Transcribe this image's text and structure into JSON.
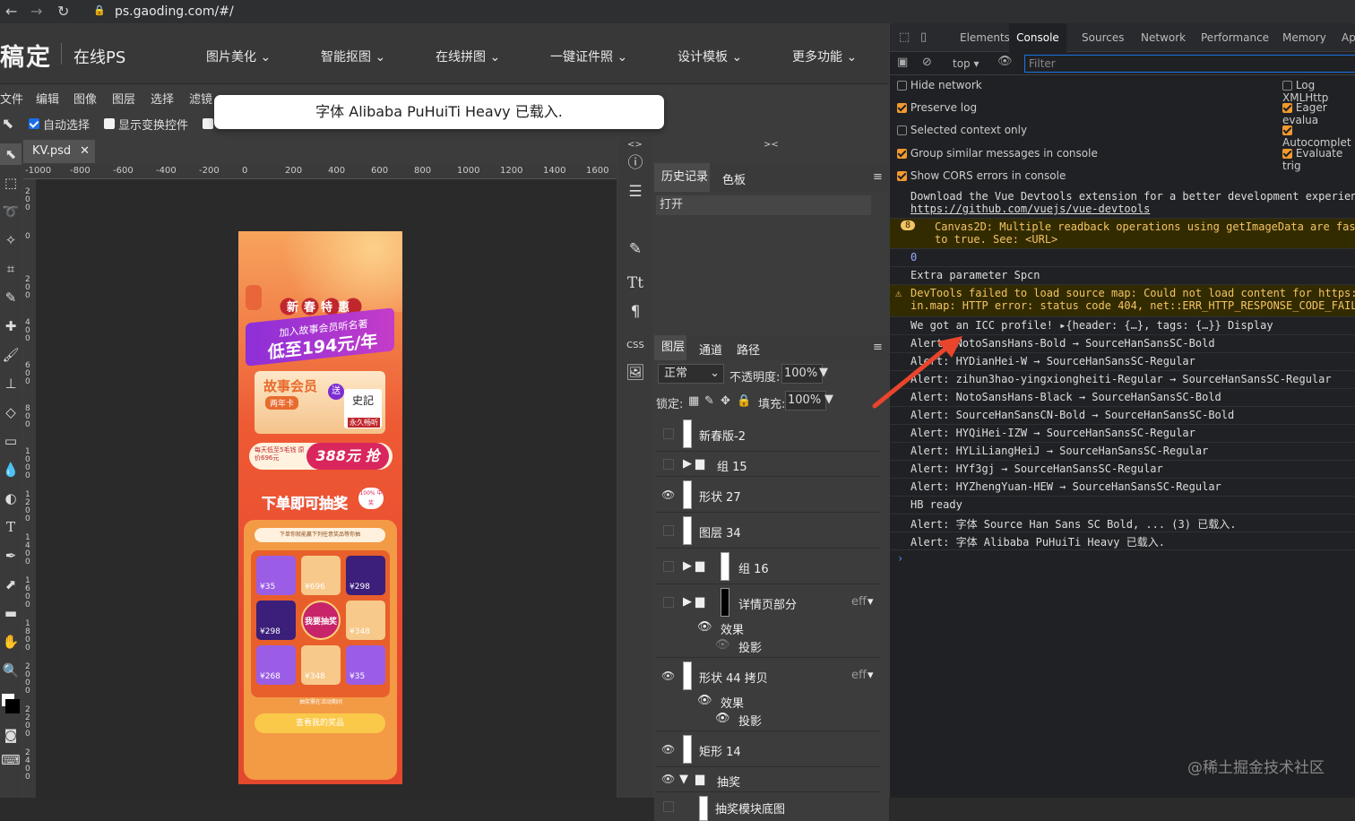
{
  "browser": {
    "url": "ps.gaoding.com/#/"
  },
  "ps": {
    "logo": "稿定",
    "logo_sub": "在线PS",
    "topnav": [
      "图片美化 ⌄",
      "智能抠图 ⌄",
      "在线拼图 ⌄",
      "一键证件照 ⌄",
      "设计模板 ⌄",
      "更多功能 ⌄"
    ],
    "menus": [
      "文件",
      "编辑",
      "图像",
      "图层",
      "选择",
      "滤镜"
    ],
    "options": {
      "auto_select": "自动选择",
      "show_transform": "显示变换控件"
    },
    "toast": "字体 Alibaba PuHuiTi Heavy 已载入.",
    "doc_tab": "KV.psd",
    "ruler_h": [
      "-1000",
      "-800",
      "-600",
      "-400",
      "-200",
      "0",
      "200",
      "400",
      "600",
      "800",
      "1000",
      "1200",
      "1400",
      "1600"
    ],
    "ruler_v": [
      "200",
      "0",
      "200",
      "400",
      "600",
      "800",
      "1000",
      "1200",
      "1400",
      "1600",
      "1800",
      "2000",
      "2200",
      "2400"
    ],
    "history": {
      "tabs": [
        "历史记录",
        "色板"
      ],
      "item": "打开"
    },
    "layers_panel": {
      "tabs": [
        "图层",
        "通道",
        "路径"
      ],
      "blend": "正常",
      "opacity_label": "不透明度:",
      "opacity": "100%",
      "lock_label": "锁定:",
      "fill_label": "填充:",
      "fill": "100%",
      "layers": [
        "新春版-2",
        "组 15",
        "形状 27",
        "图层 34",
        "组 16",
        "详情页部分",
        "效果",
        "投影",
        "形状 44 拷贝",
        "效果",
        "投影",
        "矩形 14",
        "抽奖",
        "抽奖模块底图"
      ],
      "eff": "eff"
    },
    "artboard": {
      "badge": "新春特惠",
      "headline1": "加入故事会员听名著",
      "headline2": "低至194元/年",
      "card_title": "故事会员",
      "card_sub": "两年卡",
      "gift": "送",
      "book": "史記",
      "book_sub": "永久畅听",
      "price_small": "每天低至5毛钱 原价696元",
      "price_big": "388元 抢",
      "lottery": "下单即可抽奖",
      "lottery_badge": "100% 中奖",
      "grid_title": "下单你就能赢下列任意奖品等你抽",
      "grid_prices": [
        "¥35",
        "¥696",
        "¥298",
        "¥298",
        "",
        "¥348",
        "¥268",
        "¥348",
        "¥35"
      ],
      "center_btn": "我要抽奖",
      "btn": "查看我的奖品",
      "footnote": "抽奖需在活动期间"
    }
  },
  "devtools": {
    "tabs": [
      "Elements",
      "Console",
      "Sources",
      "Network",
      "Performance",
      "Memory",
      "Ap"
    ],
    "context": "top ▾",
    "filter_placeholder": "Filter",
    "options_left": [
      "Hide network",
      "Preserve log",
      "Selected context only",
      "Group similar messages in console",
      "Show CORS errors in console"
    ],
    "options_right": [
      "Log XMLHttp",
      "Eager evalua",
      "Autocomplet",
      "Evaluate trig"
    ],
    "logs": {
      "l1a": "Download the Vue Devtools extension for a better development experience",
      "l1b": "https://github.com/vuejs/vue-devtools",
      "l2count": "8",
      "l2a": "Canvas2D: Multiple readback operations using getImageData are faste",
      "l2b": "to true. See: <URL>",
      "l3": "0",
      "l4": "Extra parameter Spcn",
      "l5a": "DevTools failed to load source map: Could not load content for https://",
      "l5b": "in.map: HTTP error: status code 404, net::ERR_HTTP_RESPONSE_CODE_FAILUR",
      "l6": "We got an ICC profile! ▸{header: {…}, tags: {…}} Display",
      "alerts": [
        "Alert: NotoSansHans-Bold → SourceHanSansSC-Bold",
        "Alert: HYDianHei-W → SourceHanSansSC-Regular",
        "Alert: zihun3hao-yingxiongheiti-Regular → SourceHanSansSC-Regular",
        "Alert: NotoSansHans-Black → SourceHanSansSC-Bold",
        "Alert: SourceHanSansCN-Bold → SourceHanSansSC-Bold",
        "Alert: HYQiHei-IZW → SourceHanSansSC-Regular",
        "Alert: HYLiLiangHeiJ → SourceHanSansSC-Regular",
        "Alert: HYf3gj → SourceHanSansSC-Regular",
        "Alert: HYZhengYuan-HEW → SourceHanSansSC-Regular"
      ],
      "hb": "HB ready",
      "f1": "Alert: 字体 Source Han Sans SC Bold, ... (3) 已载入.",
      "f2": "Alert: 字体 Alibaba PuHuiTi Heavy 已载入.",
      "prompt": "›"
    }
  },
  "watermark": "@稀土掘金技术社区"
}
